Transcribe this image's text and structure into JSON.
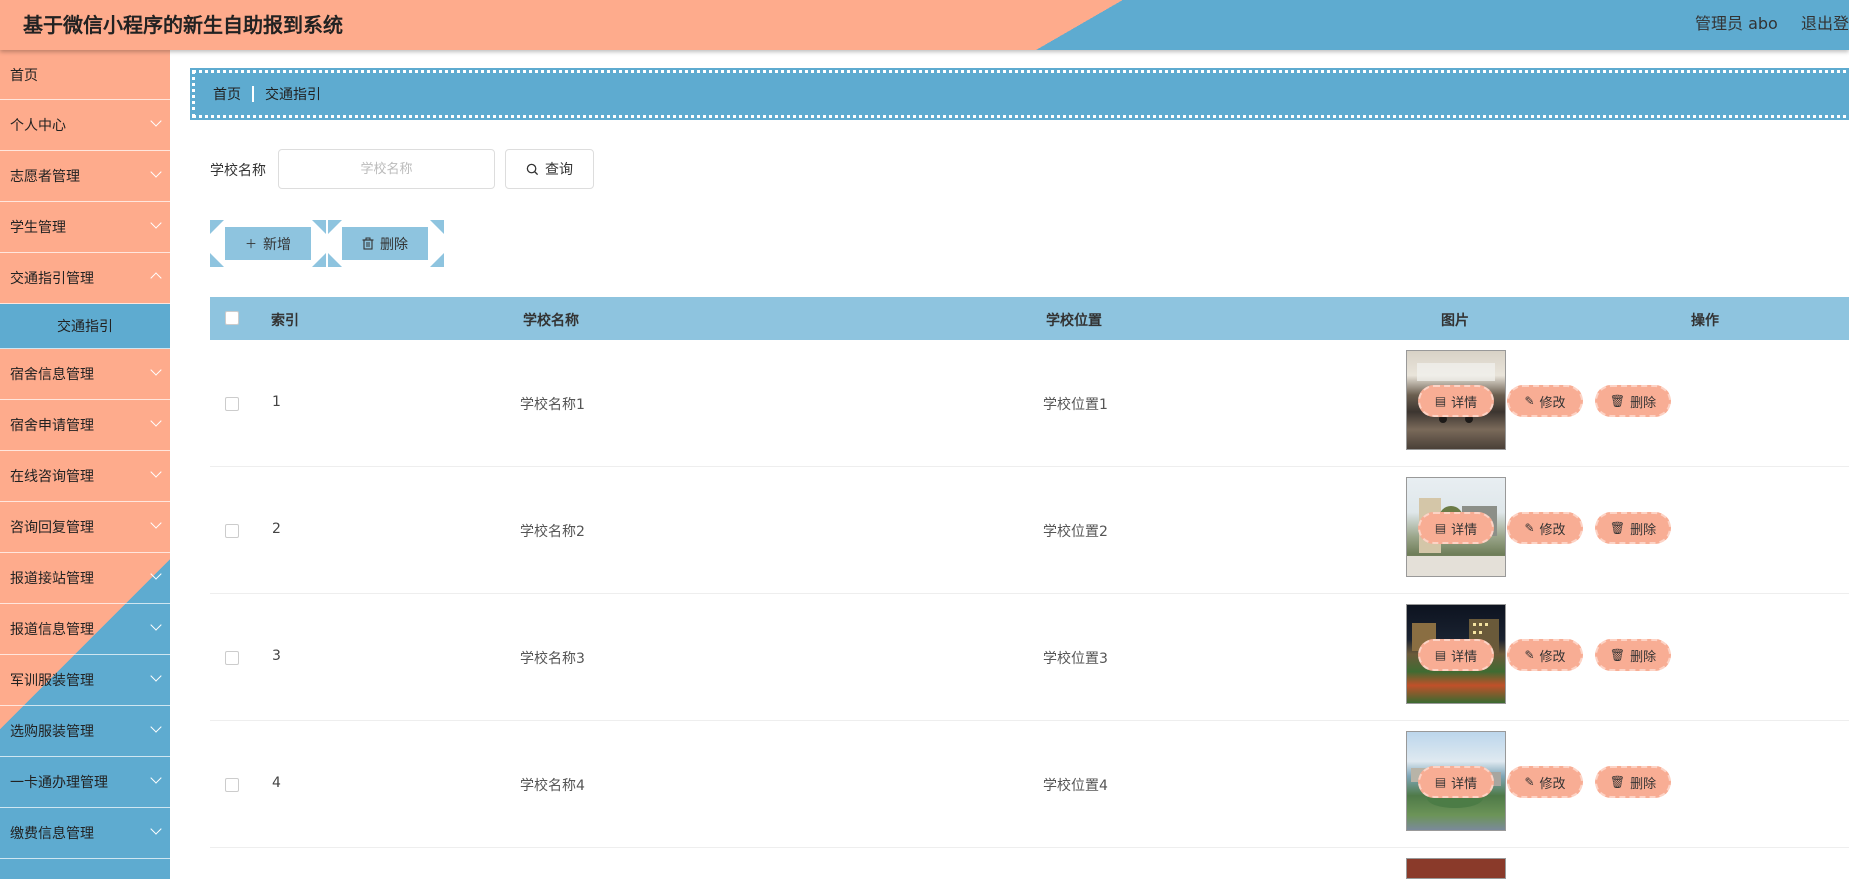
{
  "header": {
    "title": "基于微信小程序的新生自助报到系统",
    "user": "管理员 abo",
    "logout": "退出登录"
  },
  "sidebar": {
    "items": [
      {
        "label": "首页",
        "chevron": false
      },
      {
        "label": "个人中心",
        "chevron": true
      },
      {
        "label": "志愿者管理",
        "chevron": true
      },
      {
        "label": "学生管理",
        "chevron": true
      },
      {
        "label": "交通指引管理",
        "chevron": true
      },
      {
        "label": "交通指引",
        "chevron": false,
        "sub": true
      },
      {
        "label": "宿舍信息管理",
        "chevron": true
      },
      {
        "label": "宿舍申请管理",
        "chevron": true
      },
      {
        "label": "在线咨询管理",
        "chevron": true
      },
      {
        "label": "咨询回复管理",
        "chevron": true
      },
      {
        "label": "报道接站管理",
        "chevron": true
      },
      {
        "label": "报道信息管理",
        "chevron": true
      },
      {
        "label": "军训服装管理",
        "chevron": true
      },
      {
        "label": "选购服装管理",
        "chevron": true
      },
      {
        "label": "一卡通办理管理",
        "chevron": true
      },
      {
        "label": "缴费信息管理",
        "chevron": true
      }
    ]
  },
  "breadcrumb": {
    "home": "首页",
    "current": "交通指引"
  },
  "search": {
    "label": "学校名称",
    "placeholder": "学校名称",
    "button": "查询"
  },
  "actions": {
    "add": "新增",
    "delete": "删除"
  },
  "table": {
    "headers": {
      "index": "索引",
      "name": "学校名称",
      "location": "学校位置",
      "image": "图片",
      "ops": "操作"
    },
    "ops": {
      "detail": "详情",
      "edit": "修改",
      "remove": "删除"
    },
    "rows": [
      {
        "index": "1",
        "name": "学校名称1",
        "location": "学校位置1",
        "image": "meeting-room-photo"
      },
      {
        "index": "2",
        "name": "学校名称2",
        "location": "学校位置2",
        "image": "campus-courtyard-photo"
      },
      {
        "index": "3",
        "name": "学校名称3",
        "location": "学校位置3",
        "image": "sports-field-night-photo"
      },
      {
        "index": "4",
        "name": "学校名称4",
        "location": "学校位置4",
        "image": "campus-aerial-photo"
      }
    ]
  },
  "colors": {
    "peach": "#feab8c",
    "blue": "#5eabd0",
    "light_blue": "#8ec4df",
    "op_button": "#f8ad94"
  }
}
